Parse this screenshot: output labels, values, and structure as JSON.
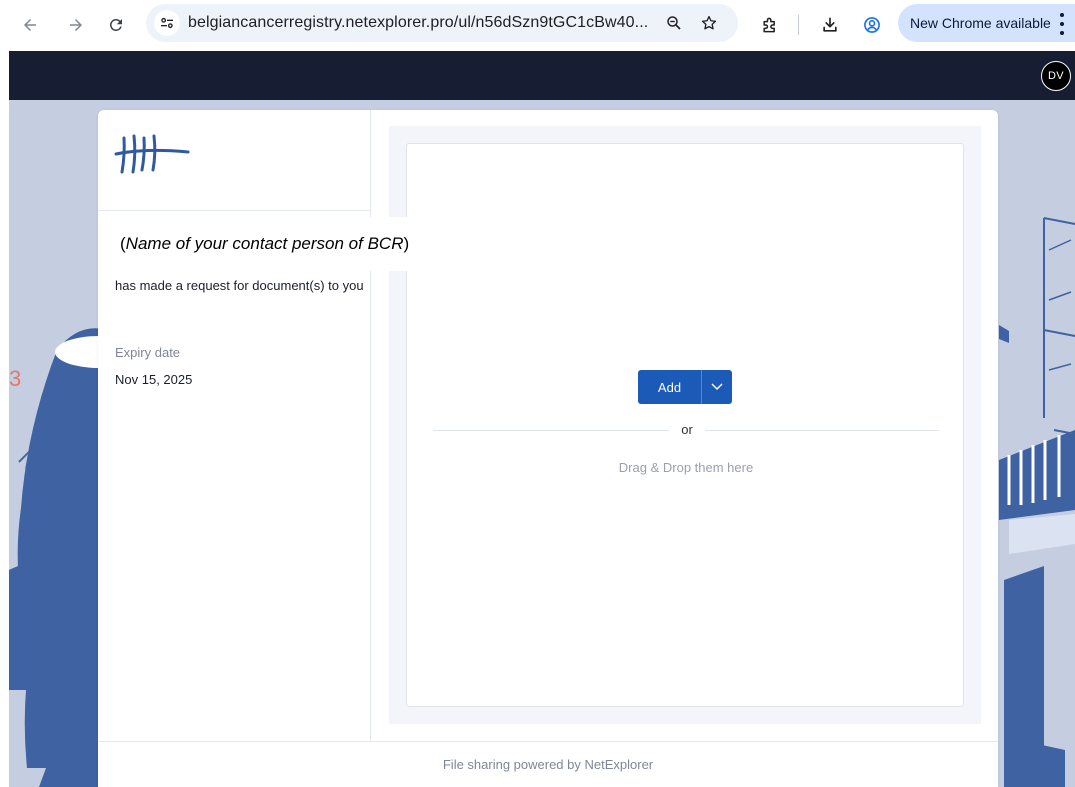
{
  "browser": {
    "url": "belgiancancerregistry.netexplorer.pro/ul/n56dSzn9tGC1cBw40...",
    "update_label": "New Chrome available"
  },
  "header": {
    "avatar_initials": "DV"
  },
  "annotation": {
    "open": "(",
    "italic_text": "Name of your contact person of BCR",
    "close": ")"
  },
  "request": {
    "message": "has made a request for document(s) to you",
    "expiry_label": "Expiry date",
    "expiry_value": "Nov 15, 2025"
  },
  "upload": {
    "add_label": "Add",
    "or_label": "or",
    "drag_label": "Drag & Drop them here"
  },
  "footer": {
    "text": "File sharing powered by NetExplorer"
  },
  "colors": {
    "header_bg": "#171d33",
    "accent_blue": "#1b5ab6",
    "page_bg": "#c5cde0",
    "illustration": "#3e62a2",
    "update_chip": "#d3e3fd"
  },
  "icons": {
    "back": "arrow-left-icon",
    "forward": "arrow-right-icon",
    "reload": "reload-icon",
    "site_info": "tune-icon",
    "zoom": "zoom-icon",
    "bookmark": "star-icon",
    "extensions": "puzzle-icon",
    "downloads": "download-icon",
    "profile": "profile-icon",
    "menu": "kebab-menu-icon",
    "add_dropdown": "chevron-down-icon"
  }
}
